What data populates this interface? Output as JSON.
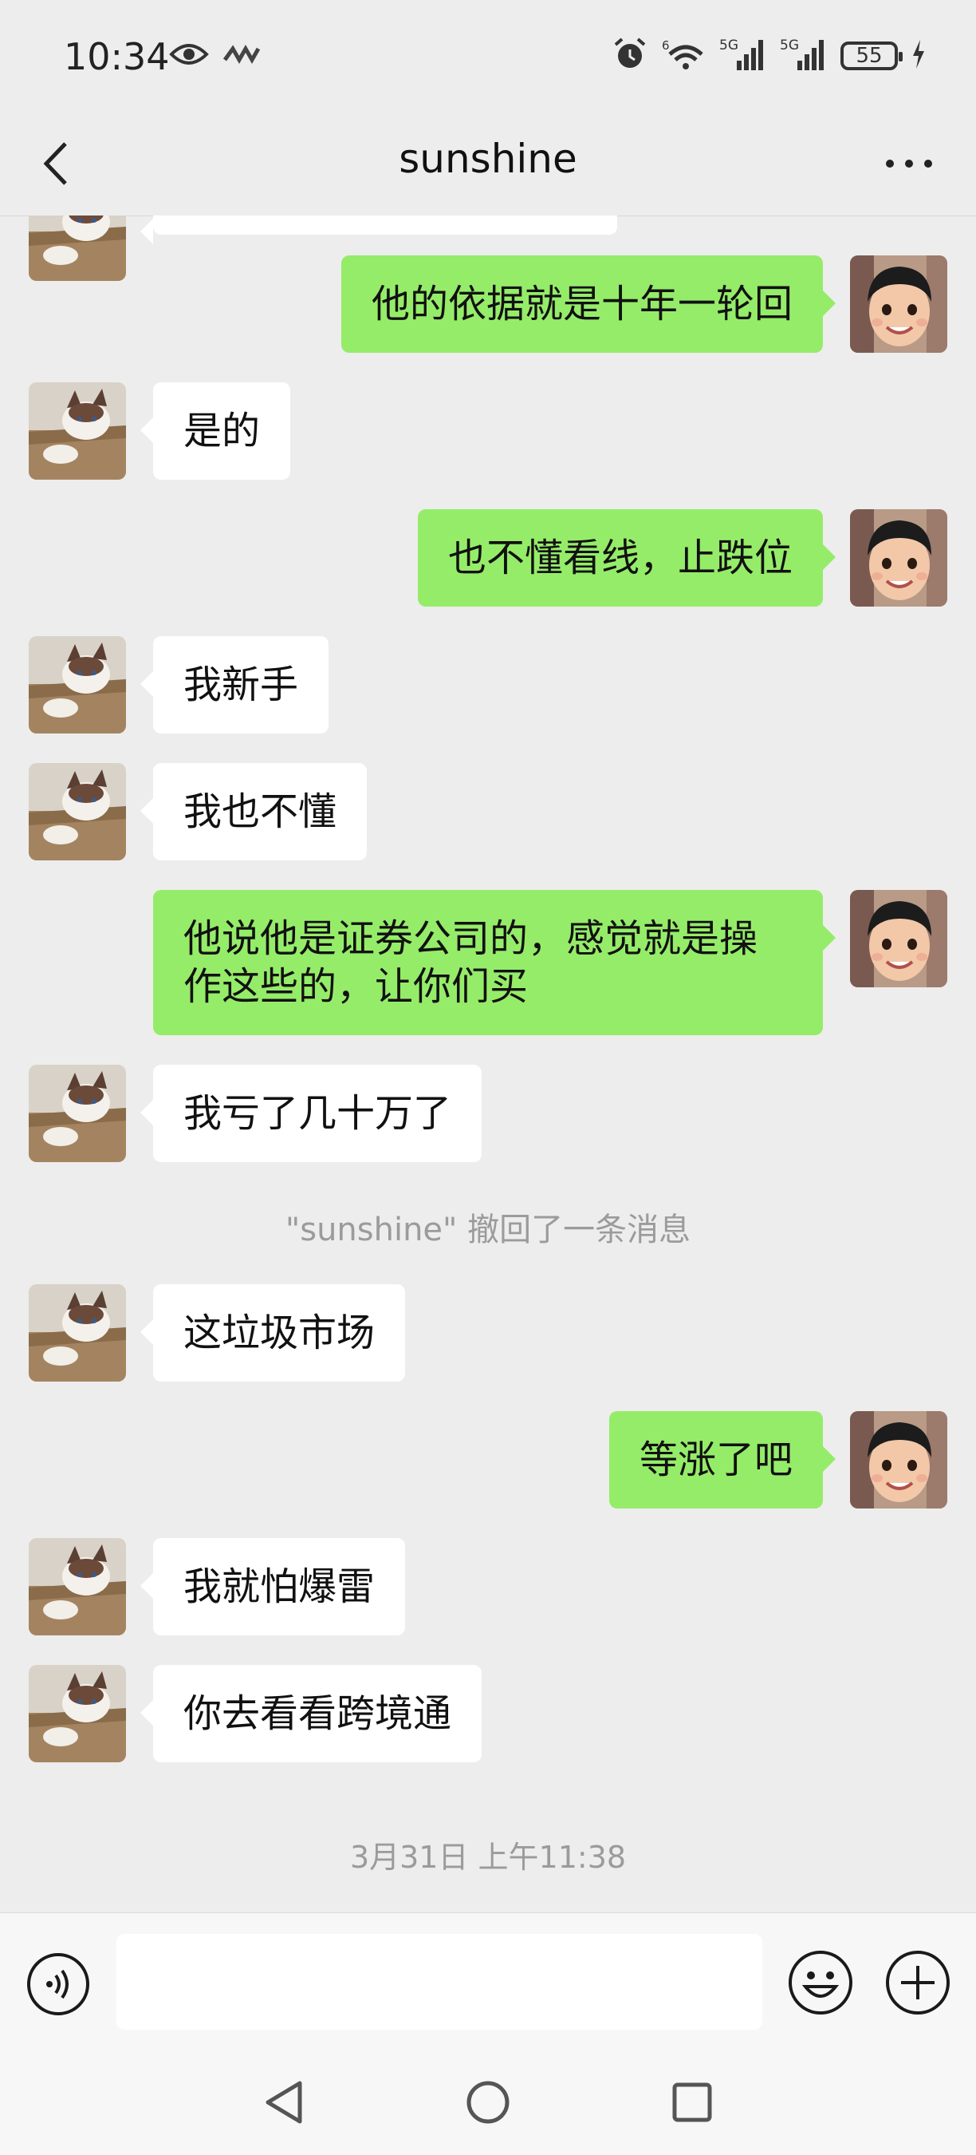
{
  "status_bar": {
    "time": "10:34",
    "battery": "55",
    "network_labels": [
      "5G",
      "5G"
    ],
    "icons": [
      "eye-icon",
      "wave-icon",
      "alarm-icon",
      "wifi-icon",
      "signal-icon",
      "signal-icon",
      "battery-icon",
      "charging-icon"
    ]
  },
  "header": {
    "title": "sunshine",
    "icons": [
      "back-arrow-icon",
      "more-icon"
    ]
  },
  "messages": [
    {
      "side": "out",
      "text": "他的依据就是十年一轮回",
      "avatar": "boy-avatar"
    },
    {
      "side": "in",
      "text": "是的",
      "avatar": "cat-avatar"
    },
    {
      "side": "out",
      "text": "也不懂看线，止跌位",
      "avatar": "boy-avatar"
    },
    {
      "side": "in",
      "text": "我新手",
      "avatar": "cat-avatar"
    },
    {
      "side": "in",
      "text": "我也不懂",
      "avatar": "cat-avatar"
    },
    {
      "side": "out",
      "text": "他说他是证券公司的，感觉就是操作这些的，让你们买",
      "avatar": "boy-avatar"
    },
    {
      "side": "in",
      "text": "我亏了几十万了",
      "avatar": "cat-avatar"
    },
    {
      "side": "in",
      "text": "这垃圾市场",
      "avatar": "cat-avatar"
    },
    {
      "side": "out",
      "text": "等涨了吧",
      "avatar": "boy-avatar"
    },
    {
      "side": "in",
      "text": "我就怕爆雷",
      "avatar": "cat-avatar"
    },
    {
      "side": "in",
      "text": "你去看看跨境通",
      "avatar": "cat-avatar"
    }
  ],
  "system_messages": {
    "recall": "\"sunshine\" 撤回了一条消息",
    "timestamp": "3月31日 上午11:38"
  },
  "input_bar": {
    "text_value": "",
    "icons": [
      "voice-icon",
      "emoji-icon",
      "plus-icon"
    ]
  },
  "nav_bar": {
    "icons": [
      "nav-back-icon",
      "nav-home-icon",
      "nav-recent-icon"
    ]
  },
  "colors": {
    "background": "#ededed",
    "incoming_bubble": "#ffffff",
    "outgoing_bubble": "#95ec69",
    "system_text": "#9b9b9b"
  }
}
